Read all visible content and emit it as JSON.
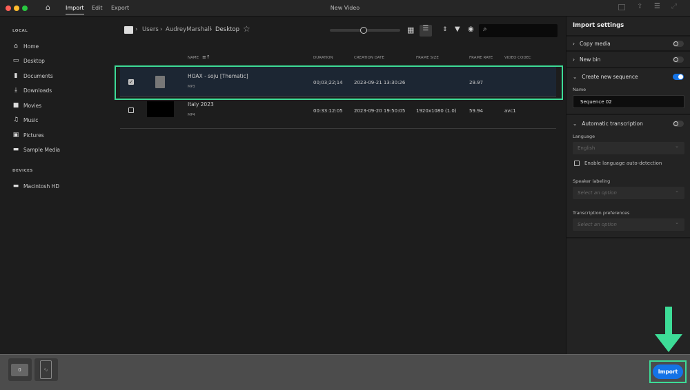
{
  "window": {
    "title": "New Video",
    "tabs": [
      {
        "label": "Import",
        "active": true
      },
      {
        "label": "Edit"
      },
      {
        "label": "Export"
      }
    ]
  },
  "sidebar": {
    "local_label": "LOCAL",
    "devices_label": "DEVICES",
    "items": [
      {
        "label": "Home",
        "icon": "home-icon"
      },
      {
        "label": "Desktop",
        "icon": "monitor-icon"
      },
      {
        "label": "Documents",
        "icon": "document-icon"
      },
      {
        "label": "Downloads",
        "icon": "download-icon"
      },
      {
        "label": "Movies",
        "icon": "video-camera-icon"
      },
      {
        "label": "Music",
        "icon": "music-note-icon"
      },
      {
        "label": "Pictures",
        "icon": "image-icon"
      },
      {
        "label": "Sample Media",
        "icon": "folder-icon"
      }
    ],
    "devices": [
      {
        "label": "Macintosh HD",
        "icon": "folder-icon"
      }
    ]
  },
  "breadcrumb": [
    "Users",
    "AudreyMarshall",
    "Desktop"
  ],
  "search": {
    "placeholder": ""
  },
  "thumbnail_size": 0.5,
  "table": {
    "headers": {
      "name": "NAME",
      "duration": "DURATION",
      "date": "CREATION DATE",
      "frame_size": "FRAME SIZE",
      "frame_rate": "FRAME RATE",
      "codec": "VIDEO CODEC"
    },
    "rows": [
      {
        "name": "HOAX - soju [Thematic]",
        "type": "MP3",
        "duration": "00;03;22;14",
        "date": "2023-09-21 13:30:26",
        "frame_size": "",
        "frame_rate": "29.97",
        "codec": "",
        "checked": true
      },
      {
        "name": "Italy 2023",
        "type": "MP4",
        "duration": "00:33:12:05",
        "date": "2023-09-20 19:50:05",
        "frame_size": "1920x1080 (1.0)",
        "frame_rate": "59.94",
        "codec": "avc1",
        "checked": false
      }
    ]
  },
  "panel": {
    "title": "Import settings",
    "copy_media": {
      "label": "Copy media",
      "on": false
    },
    "new_bin": {
      "label": "New bin",
      "on": false
    },
    "new_sequence": {
      "label": "Create new sequence",
      "on": true,
      "name_label": "Name",
      "name_value": "Sequence 02"
    },
    "transcription": {
      "label": "Automatic transcription",
      "on": false,
      "language_label": "Language",
      "language_value": "English",
      "auto_detect_label": "Enable language auto-detection",
      "speaker_label": "Speaker labeling",
      "speaker_placeholder": "Select an option",
      "prefs_label": "Transcription preferences",
      "prefs_placeholder": "Select an option"
    }
  },
  "bottom": {
    "bin_count": "0",
    "import_label": "Import"
  },
  "colors": {
    "accent": "#1473e6",
    "highlight": "#3ddc97"
  }
}
